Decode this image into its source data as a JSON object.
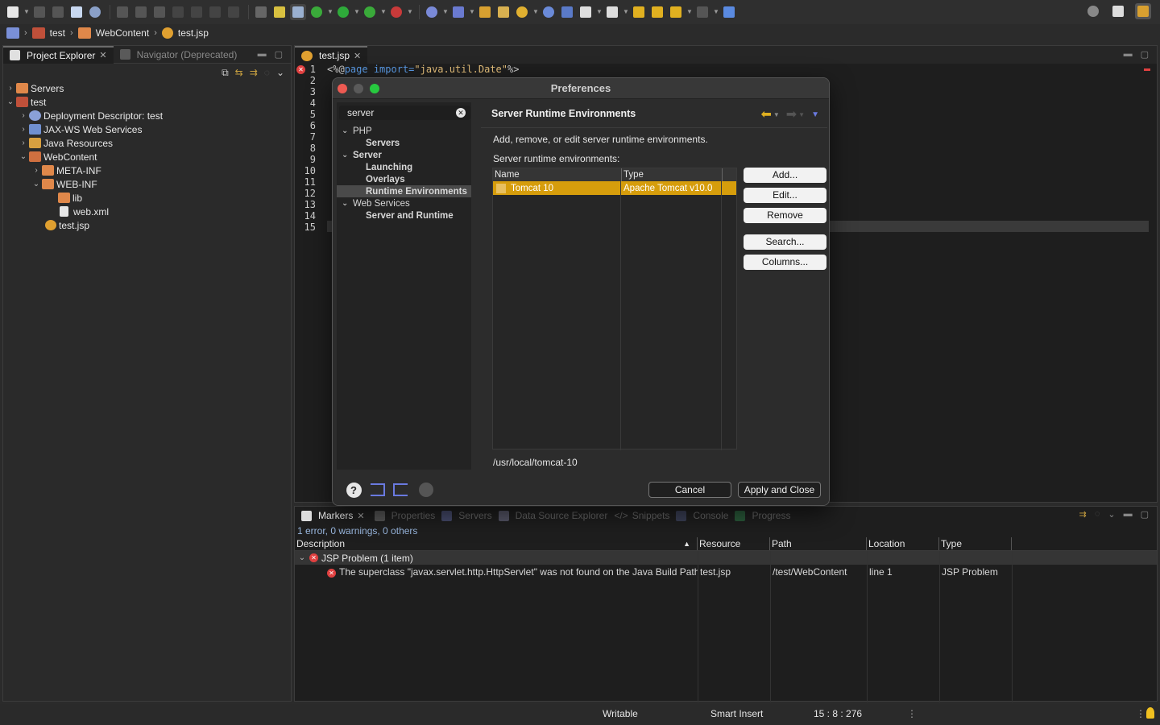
{
  "breadcrumb": {
    "items": [
      "test",
      "WebContent",
      "test.jsp"
    ]
  },
  "left_panel": {
    "tabs": [
      {
        "label": "Project Explorer",
        "active": true
      },
      {
        "label": "Navigator (Deprecated)",
        "active": false
      }
    ],
    "tree": [
      {
        "label": "Servers",
        "depth": 0,
        "expanded": false,
        "icon": "folder-icon"
      },
      {
        "label": "test",
        "depth": 0,
        "expanded": true,
        "icon": "project-icon"
      },
      {
        "label": "Deployment Descriptor: test",
        "depth": 1,
        "expanded": false,
        "icon": "descriptor-icon"
      },
      {
        "label": "JAX-WS Web Services",
        "depth": 1,
        "expanded": false,
        "icon": "web-services-icon"
      },
      {
        "label": "Java Resources",
        "depth": 1,
        "expanded": false,
        "icon": "java-resources-icon"
      },
      {
        "label": "WebContent",
        "depth": 1,
        "expanded": true,
        "icon": "folder-icon"
      },
      {
        "label": "META-INF",
        "depth": 2,
        "expanded": false,
        "icon": "folder-icon"
      },
      {
        "label": "WEB-INF",
        "depth": 2,
        "expanded": true,
        "icon": "folder-icon"
      },
      {
        "label": "lib",
        "depth": 3,
        "expanded": null,
        "icon": "folder-icon"
      },
      {
        "label": "web.xml",
        "depth": 3,
        "expanded": null,
        "icon": "xml-file-icon"
      },
      {
        "label": "test.jsp",
        "depth": 2,
        "expanded": null,
        "icon": "jsp-file-icon"
      }
    ]
  },
  "editor": {
    "tab_label": "test.jsp",
    "line_numbers": [
      "1",
      "2",
      "3",
      "4",
      "5",
      "6",
      "7",
      "8",
      "9",
      "10",
      "11",
      "12",
      "13",
      "14",
      "15"
    ],
    "first_line": {
      "open": "<%@",
      "keyword": "page",
      "attr": "import=",
      "value": "\"java.util.Date\"",
      "close": "%>"
    }
  },
  "dialog": {
    "title": "Preferences",
    "filter_value": "server",
    "tree": [
      {
        "label": "PHP",
        "level": 0,
        "bold": false,
        "chevron": "v"
      },
      {
        "label": "Servers",
        "level": 1,
        "bold": true
      },
      {
        "label": "Server",
        "level": 0,
        "bold": true,
        "chevron": "v"
      },
      {
        "label": "Launching",
        "level": 1,
        "bold": true
      },
      {
        "label": "Overlays",
        "level": 1,
        "bold": true
      },
      {
        "label": "Runtime Environments",
        "level": 1,
        "bold": true,
        "selected": true
      },
      {
        "label": "Web Services",
        "level": 0,
        "bold": false,
        "chevron": "v"
      },
      {
        "label": "Server and Runtime",
        "level": 1,
        "bold": true
      }
    ],
    "page_title": "Server Runtime Environments",
    "description": "Add, remove, or edit server runtime environments.",
    "list_label": "Server runtime environments:",
    "table": {
      "columns": [
        "Name",
        "Type"
      ],
      "rows": [
        {
          "name": "Tomcat 10",
          "type": "Apache Tomcat v10.0"
        }
      ]
    },
    "buttons": {
      "add": "Add...",
      "edit": "Edit...",
      "remove": "Remove",
      "search": "Search...",
      "columns": "Columns..."
    },
    "runtime_path": "/usr/local/tomcat-10",
    "footer": {
      "cancel": "Cancel",
      "apply_close": "Apply and Close"
    }
  },
  "bottom_panel": {
    "tabs": [
      "Markers",
      "Properties",
      "Servers",
      "Data Source Explorer",
      "Snippets",
      "Console",
      "Progress"
    ],
    "summary": "1 error, 0 warnings, 0 others",
    "columns": [
      "Description",
      "Resource",
      "Path",
      "Location",
      "Type"
    ],
    "group": "JSP Problem (1 item)",
    "problem": {
      "description": "The superclass \"javax.servlet.http.HttpServlet\" was not found on the Java Build Path",
      "resource": "test.jsp",
      "path": "/test/WebContent",
      "location": "line 1",
      "type": "JSP Problem"
    }
  },
  "status_bar": {
    "writable": "Writable",
    "insert_mode": "Smart Insert",
    "position": "15 : 8 : 276"
  },
  "colors": {
    "selection": "#d69d0c",
    "error": "#e04040",
    "accent_blue": "#5a9be6"
  }
}
